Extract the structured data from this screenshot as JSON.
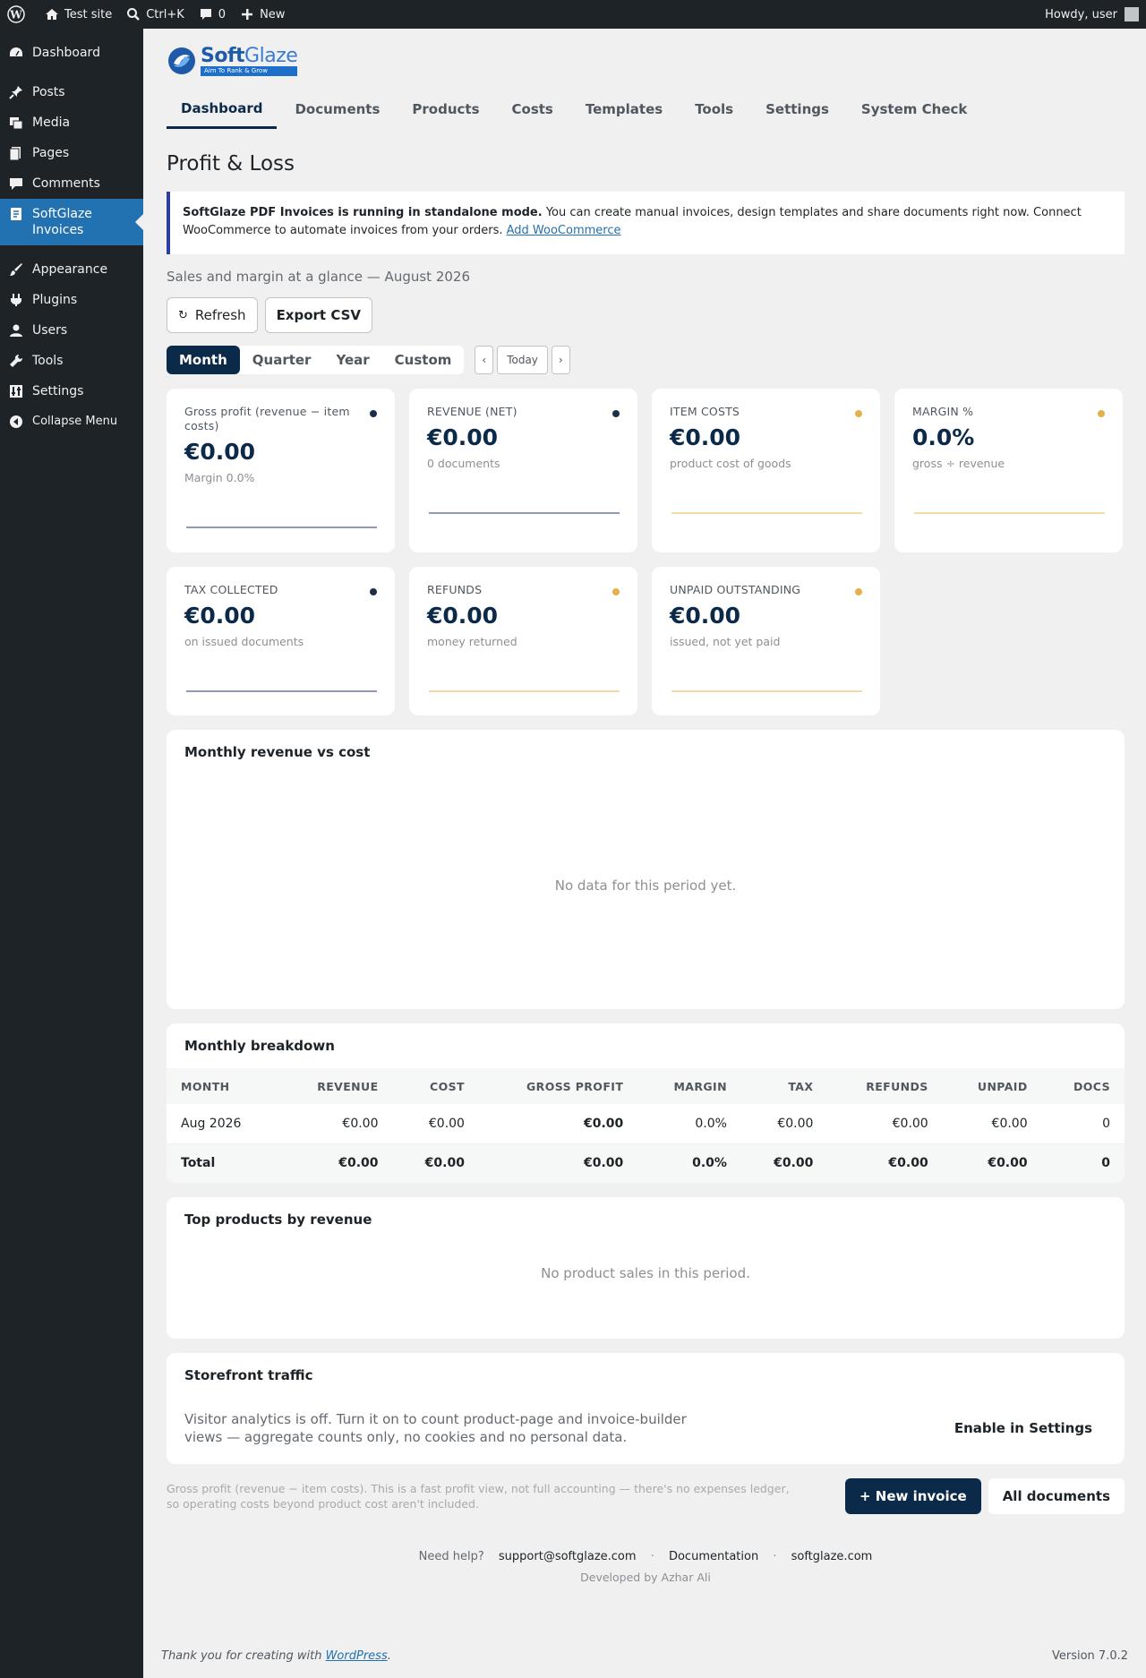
{
  "adminbar": {
    "site_name": "Test site",
    "search_shortcut": "Ctrl+K",
    "comments_count": "0",
    "new_label": "New",
    "greeting": "Howdy, user"
  },
  "sidebar": {
    "items": [
      {
        "label": "Dashboard",
        "icon": "dashboard-icon"
      },
      {
        "label": "Posts",
        "icon": "pin-icon"
      },
      {
        "label": "Media",
        "icon": "media-icon"
      },
      {
        "label": "Pages",
        "icon": "pages-icon"
      },
      {
        "label": "Comments",
        "icon": "comment-icon"
      },
      {
        "label": "SoftGlaze Invoices",
        "icon": "document-icon"
      },
      {
        "label": "Appearance",
        "icon": "brush-icon"
      },
      {
        "label": "Plugins",
        "icon": "plug-icon"
      },
      {
        "label": "Users",
        "icon": "user-icon"
      },
      {
        "label": "Tools",
        "icon": "wrench-icon"
      },
      {
        "label": "Settings",
        "icon": "settings-icon"
      },
      {
        "label": "Collapse Menu",
        "icon": "collapse-icon"
      }
    ]
  },
  "brand": {
    "name_a": "Soft",
    "name_b": "Glaze",
    "tagline": "Aim To Rank & Grow"
  },
  "tabs": [
    "Dashboard",
    "Documents",
    "Products",
    "Costs",
    "Templates",
    "Tools",
    "Settings",
    "System Check"
  ],
  "page_title": "Profit & Loss",
  "notice": {
    "bold": "SoftGlaze PDF Invoices is running in standalone mode.",
    "text": " You can create manual invoices, design templates and share documents right now. Connect WooCommerce to automate invoices from your orders. ",
    "link": "Add WooCommerce"
  },
  "subtitle": "Sales and margin at a glance — August 2026",
  "actions": {
    "refresh": "Refresh",
    "export": "Export CSV"
  },
  "period": {
    "options": [
      "Month",
      "Quarter",
      "Year",
      "Custom"
    ],
    "selected": "Month",
    "prev": "‹",
    "today": "Today",
    "next": "›"
  },
  "cards": [
    {
      "label": "Gross profit (revenue − item costs)",
      "value": "€0.00",
      "sub": "Margin 0.0%",
      "color": "#1d2d4a"
    },
    {
      "label": "REVENUE (NET)",
      "value": "€0.00",
      "sub": "0 documents",
      "color": "#1d2d4a"
    },
    {
      "label": "ITEM COSTS",
      "value": "€0.00",
      "sub": "product cost of goods",
      "color": "#e5b04a"
    },
    {
      "label": "MARGIN %",
      "value": "0.0%",
      "sub": "gross ÷ revenue",
      "color": "#e5b04a"
    },
    {
      "label": "TAX COLLECTED",
      "value": "€0.00",
      "sub": "on issued documents",
      "color": "#1d2d4a"
    },
    {
      "label": "REFUNDS",
      "value": "€0.00",
      "sub": "money returned",
      "color": "#e5b04a"
    },
    {
      "label": "UNPAID OUTSTANDING",
      "value": "€0.00",
      "sub": "issued, not yet paid",
      "color": "#e5b04a"
    }
  ],
  "revenue_chart": {
    "title": "Monthly revenue vs cost",
    "empty": "No data for this period yet."
  },
  "breakdown": {
    "title": "Monthly breakdown",
    "headers": [
      "MONTH",
      "REVENUE",
      "COST",
      "GROSS PROFIT",
      "MARGIN",
      "TAX",
      "REFUNDS",
      "UNPAID",
      "DOCS"
    ],
    "rows": [
      [
        "Aug 2026",
        "€0.00",
        "€0.00",
        "€0.00",
        "0.0%",
        "€0.00",
        "€0.00",
        "€0.00",
        "0"
      ]
    ],
    "total": [
      "Total",
      "€0.00",
      "€0.00",
      "€0.00",
      "0.0%",
      "€0.00",
      "€0.00",
      "€0.00",
      "0"
    ]
  },
  "top_products": {
    "title": "Top products by revenue",
    "empty": "No product sales in this period."
  },
  "traffic": {
    "title": "Storefront traffic",
    "text": "Visitor analytics is off. Turn it on to count product-page and invoice-builder views — aggregate counts only, no cookies and no personal data.",
    "button": "Enable in Settings"
  },
  "footer_note": "Gross profit (revenue − item costs). This is a fast profit view, not full accounting — there's no expenses ledger, so operating costs beyond product cost aren't included.",
  "footer_buttons": {
    "new_invoice": "+ New invoice",
    "all_documents": "All documents"
  },
  "help": {
    "label": "Need help?",
    "email": "support@softglaze.com",
    "docs": "Documentation",
    "site": "softglaze.com",
    "sep": "·",
    "developer": "Developed by Azhar Ali"
  },
  "wp_footer": {
    "thanks": "Thank you for creating with ",
    "wp_link": "WordPress",
    "period": ".",
    "version": "Version 7.0.2"
  }
}
